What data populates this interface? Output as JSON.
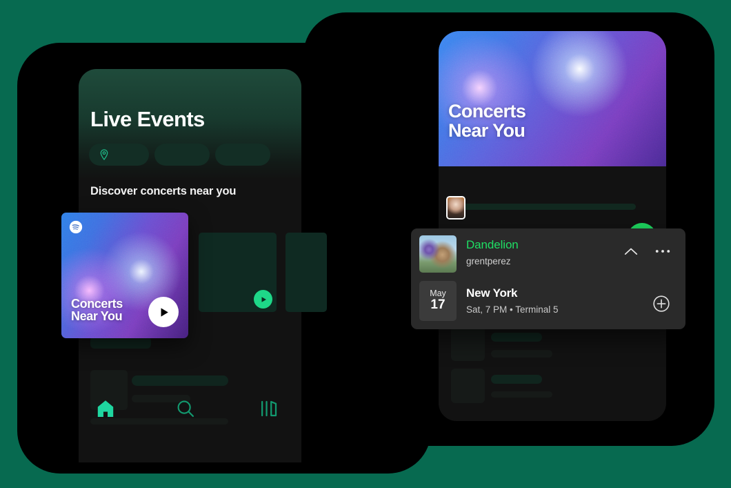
{
  "background": {
    "color": "#076a50",
    "panel_color": "#000000"
  },
  "left_phone": {
    "header_title": "Live Events",
    "section_label": "Discover concerts near you",
    "filter_pills": [
      {
        "name": "location-pill",
        "icon": "location-pin-icon",
        "label": ""
      },
      {
        "name": "filter-pill-2",
        "icon": "",
        "label": ""
      },
      {
        "name": "filter-pill-3",
        "icon": "",
        "label": ""
      }
    ],
    "featured_card": {
      "title_line1": "Concerts",
      "title_line2": "Near You",
      "logo": "spotify-logo-icon",
      "play": "play-icon"
    },
    "placeholder_play": "play-icon",
    "bottom_nav": [
      {
        "name": "home",
        "icon": "home-icon",
        "active": true
      },
      {
        "name": "search",
        "icon": "search-icon",
        "active": false
      },
      {
        "name": "library",
        "icon": "library-icon",
        "active": false
      }
    ]
  },
  "right_phone": {
    "hero_title_line1": "Concerts",
    "hero_title_line2": "Near You",
    "actions": [
      {
        "name": "avatar",
        "icon": "avatar-icon"
      },
      {
        "name": "add",
        "icon": "plus-circle-icon"
      },
      {
        "name": "download",
        "icon": "download-circle-icon"
      },
      {
        "name": "shuffle",
        "icon": "shuffle-icon"
      },
      {
        "name": "play",
        "icon": "play-icon"
      }
    ],
    "event_card": {
      "event_name": "Dandelion",
      "artist": "grentperez",
      "month": "May",
      "day": "17",
      "city": "New York",
      "details": "Sat, 7 PM • Terminal 5",
      "collapse_icon": "chevron-up-icon",
      "more_icon": "more-horizontal-icon",
      "add_icon": "plus-circle-icon"
    }
  },
  "colors": {
    "spotify_green": "#1ed760",
    "accent_green": "#1fdf64",
    "teal": "#1ed788",
    "background_teal": "#076a50"
  }
}
